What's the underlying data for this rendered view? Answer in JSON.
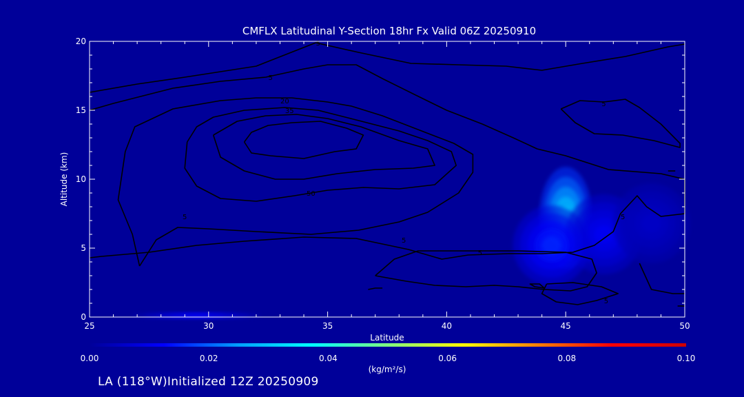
{
  "chart_data": {
    "type": "heatmap",
    "title": "CMFLX Latitudinal Y-Section 18hr  Fx Valid 06Z 20250910",
    "xlabel": "Latitude",
    "ylabel": "Altitude (km)",
    "xlim": [
      25,
      50
    ],
    "ylim": [
      0,
      20
    ],
    "x_ticks": [
      "25",
      "30",
      "35",
      "40",
      "45",
      "50"
    ],
    "y_ticks": [
      "0",
      "5",
      "10",
      "15",
      "20"
    ],
    "x_tick_values": [
      25,
      30,
      35,
      40,
      45,
      50
    ],
    "y_tick_values": [
      0,
      5,
      10,
      15,
      20
    ],
    "colorbar": {
      "label": "(kg/m²/s)",
      "min": 0,
      "max": 0.1,
      "tick_labels": [
        "0.00",
        "0.02",
        "0.04",
        "0.06",
        "0.08",
        "0.10"
      ],
      "tick_values": [
        0,
        0.02,
        0.04,
        0.06,
        0.08,
        0.1
      ],
      "colors": [
        "#000099",
        "#0000ff",
        "#00a0ff",
        "#00ffff",
        "#80ff80",
        "#ffff00",
        "#ff8000",
        "#ff0000",
        "#cc0000"
      ]
    },
    "field_blobs": [
      {
        "lat": 45.0,
        "alt": 7.2,
        "value": 0.035
      },
      {
        "lat": 46.6,
        "alt": 6.0,
        "value": 0.012
      },
      {
        "lat": 44.4,
        "alt": 5.2,
        "value": 0.016
      },
      {
        "lat": 48.6,
        "alt": 6.8,
        "value": 0.006
      },
      {
        "lat": 29.5,
        "alt": 0.1,
        "value": 0.012
      }
    ],
    "contour_labels": [
      {
        "text": "5",
        "lat": 34.6,
        "alt": 19.9
      },
      {
        "text": "5",
        "lat": 32.6,
        "alt": 17.4
      },
      {
        "text": "20",
        "lat": 33.2,
        "alt": 15.7
      },
      {
        "text": "35",
        "lat": 33.4,
        "alt": 15.0
      },
      {
        "text": "50",
        "lat": 34.3,
        "alt": 9.0
      },
      {
        "text": "5",
        "lat": 29.0,
        "alt": 7.3
      },
      {
        "text": "5",
        "lat": 38.2,
        "alt": 5.6
      },
      {
        "text": "5",
        "lat": 41.4,
        "alt": 4.7
      },
      {
        "text": "5",
        "lat": 46.6,
        "alt": 15.5
      },
      {
        "text": "5",
        "lat": 47.4,
        "alt": 7.3
      },
      {
        "text": "5",
        "lat": 46.7,
        "alt": 1.2
      }
    ],
    "contours": [
      [
        [
          25,
          16.3
        ],
        [
          27,
          16.9
        ],
        [
          29,
          17.4
        ],
        [
          32,
          18.2
        ],
        [
          34.5,
          19.9
        ],
        [
          36.3,
          19.2
        ],
        [
          38.5,
          18.4
        ],
        [
          40.5,
          18.3
        ],
        [
          42.5,
          18.2
        ],
        [
          44,
          17.9
        ],
        [
          45.7,
          18.4
        ],
        [
          47.5,
          18.9
        ],
        [
          49.3,
          19.6
        ],
        [
          50,
          19.8
        ]
      ],
      [
        [
          25,
          15.0
        ],
        [
          26,
          15.5
        ],
        [
          28.5,
          16.6
        ],
        [
          30.5,
          17.1
        ],
        [
          32.4,
          17.4
        ],
        [
          34,
          18.0
        ],
        [
          35,
          18.3
        ],
        [
          36.2,
          18.3
        ],
        [
          37.3,
          17.3
        ],
        [
          38.7,
          16.1
        ],
        [
          40,
          15.0
        ],
        [
          41.5,
          14.0
        ],
        [
          42.8,
          13.0
        ],
        [
          43.8,
          12.2
        ],
        [
          45.0,
          11.7
        ],
        [
          46.8,
          10.7
        ],
        [
          49.0,
          10.4
        ],
        [
          50,
          10.0
        ],
        [
          50,
          7.5
        ],
        [
          49,
          7.3
        ],
        [
          48.4,
          8.0
        ],
        [
          48.0,
          8.8
        ],
        [
          47.3,
          7.5
        ],
        [
          47.0,
          6.2
        ],
        [
          46.2,
          5.2
        ],
        [
          45.3,
          4.7
        ],
        [
          44.0,
          4.6
        ],
        [
          42.6,
          4.6
        ],
        [
          40.9,
          4.5
        ],
        [
          39.8,
          4.2
        ],
        [
          38.4,
          4.9
        ],
        [
          36.2,
          5.7
        ],
        [
          34.0,
          5.8
        ],
        [
          31.5,
          5.5
        ],
        [
          29.5,
          5.2
        ],
        [
          27.5,
          4.7
        ],
        [
          25.5,
          4.4
        ],
        [
          25,
          4.3
        ]
      ],
      [
        [
          27.1,
          3.7
        ],
        [
          26.8,
          6.0
        ],
        [
          26.2,
          8.5
        ],
        [
          26.5,
          12.0
        ],
        [
          26.9,
          13.8
        ],
        [
          28.5,
          15.1
        ],
        [
          30.5,
          15.7
        ],
        [
          32.0,
          15.9
        ],
        [
          33.5,
          15.9
        ],
        [
          35.0,
          15.6
        ],
        [
          36.0,
          15.3
        ],
        [
          37.3,
          14.6
        ],
        [
          38.8,
          13.6
        ],
        [
          40.3,
          12.6
        ],
        [
          41.1,
          11.8
        ],
        [
          41.1,
          10.5
        ],
        [
          40.5,
          9.0
        ],
        [
          39.2,
          7.6
        ],
        [
          38.0,
          6.9
        ],
        [
          36.3,
          6.3
        ],
        [
          34.3,
          6.0
        ],
        [
          32.0,
          6.2
        ],
        [
          30.0,
          6.4
        ],
        [
          28.7,
          6.5
        ],
        [
          27.8,
          5.6
        ],
        [
          27.1,
          3.7
        ]
      ],
      [
        [
          29.1,
          12.7
        ],
        [
          29.0,
          10.8
        ],
        [
          29.5,
          9.5
        ],
        [
          30.5,
          8.6
        ],
        [
          32.0,
          8.4
        ],
        [
          33.6,
          8.8
        ],
        [
          35.0,
          9.2
        ],
        [
          36.5,
          9.4
        ],
        [
          38.0,
          9.3
        ],
        [
          39.5,
          9.6
        ],
        [
          40.4,
          11.0
        ],
        [
          40.2,
          12.0
        ],
        [
          39.2,
          12.8
        ],
        [
          38.0,
          13.5
        ],
        [
          36.2,
          14.3
        ],
        [
          34.6,
          15.0
        ],
        [
          33.2,
          15.2
        ],
        [
          31.5,
          15.0
        ],
        [
          30.2,
          14.5
        ],
        [
          29.5,
          13.8
        ],
        [
          29.1,
          12.7
        ]
      ],
      [
        [
          30.2,
          13.2
        ],
        [
          30.5,
          11.6
        ],
        [
          31.5,
          10.6
        ],
        [
          32.8,
          10.0
        ],
        [
          34.0,
          10.0
        ],
        [
          35.4,
          10.4
        ],
        [
          37.0,
          10.7
        ],
        [
          38.6,
          10.8
        ],
        [
          39.5,
          11.0
        ],
        [
          39.2,
          12.2
        ],
        [
          38.0,
          12.8
        ],
        [
          36.4,
          13.8
        ],
        [
          35.0,
          14.4
        ],
        [
          33.7,
          14.7
        ],
        [
          32.4,
          14.6
        ],
        [
          31.2,
          14.2
        ],
        [
          30.2,
          13.2
        ]
      ],
      [
        [
          31.5,
          12.7
        ],
        [
          31.8,
          11.9
        ],
        [
          32.6,
          11.7
        ],
        [
          34.0,
          11.5
        ],
        [
          35.3,
          12.0
        ],
        [
          36.2,
          12.2
        ],
        [
          36.5,
          13.2
        ],
        [
          35.8,
          13.7
        ],
        [
          34.7,
          14.2
        ],
        [
          33.5,
          14.1
        ],
        [
          32.5,
          13.9
        ],
        [
          31.8,
          13.4
        ],
        [
          31.5,
          12.7
        ]
      ],
      [
        [
          37.0,
          3.0
        ],
        [
          37.8,
          4.2
        ],
        [
          38.8,
          4.8
        ],
        [
          40.8,
          4.8
        ],
        [
          43.0,
          4.8
        ],
        [
          45.0,
          4.7
        ],
        [
          46.1,
          4.2
        ],
        [
          46.3,
          3.2
        ],
        [
          45.9,
          2.2
        ],
        [
          45.2,
          1.9
        ],
        [
          44.1,
          2.0
        ],
        [
          43.0,
          2.2
        ],
        [
          42.0,
          2.3
        ],
        [
          40.8,
          2.2
        ],
        [
          39.5,
          2.3
        ],
        [
          38.3,
          2.6
        ],
        [
          37.0,
          3.0
        ]
      ],
      [
        [
          36.7,
          2.0
        ],
        [
          37.0,
          2.1
        ],
        [
          37.3,
          2.1
        ]
      ],
      [
        [
          44.2,
          2.4
        ],
        [
          45.3,
          2.5
        ],
        [
          46.5,
          2.2
        ],
        [
          47.2,
          1.7
        ],
        [
          46.3,
          1.2
        ],
        [
          45.5,
          0.9
        ],
        [
          44.6,
          1.1
        ],
        [
          44.0,
          1.7
        ],
        [
          44.2,
          2.4
        ]
      ],
      [
        [
          44.8,
          15.1
        ],
        [
          45.6,
          15.7
        ],
        [
          46.6,
          15.6
        ],
        [
          47.5,
          15.8
        ],
        [
          48.1,
          15.2
        ],
        [
          49.0,
          14.0
        ],
        [
          49.8,
          12.6
        ],
        [
          49.8,
          12.3
        ],
        [
          48.7,
          12.8
        ],
        [
          47.4,
          13.2
        ],
        [
          46.2,
          13.3
        ],
        [
          45.4,
          14.1
        ],
        [
          44.8,
          15.1
        ]
      ],
      [
        [
          43.7,
          2.2
        ],
        [
          43.5,
          2.4
        ],
        [
          43.9,
          2.4
        ],
        [
          44.1,
          2.1
        ],
        [
          43.7,
          2.2
        ]
      ],
      [
        [
          48.1,
          3.9
        ],
        [
          48.6,
          2.0
        ],
        [
          49.5,
          1.7
        ],
        [
          50,
          1.7
        ]
      ],
      [
        [
          50,
          0.8
        ],
        [
          49.7,
          0.8
        ]
      ],
      [
        [
          49.3,
          10.6
        ],
        [
          49.6,
          10.6
        ]
      ]
    ]
  },
  "footer": {
    "location_text": "LA (118°W)Initialized 12Z 20250909"
  }
}
